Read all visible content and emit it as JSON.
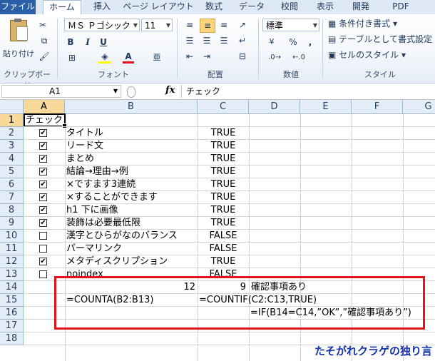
{
  "tabs": [
    "ファイル",
    "ホーム",
    "挿入",
    "ページ レイアウト",
    "数式",
    "データ",
    "校閲",
    "表示",
    "開発",
    "PDF"
  ],
  "ribbon": {
    "clipboard": {
      "paste": "貼り付け",
      "label": "クリップボード"
    },
    "font": {
      "name": "ＭＳ Ｐゴシック",
      "size": "11",
      "label": "フォント"
    },
    "alignment": {
      "label": "配置"
    },
    "number": {
      "format": "標準",
      "label": "数値"
    },
    "styles": {
      "conditional": "条件付き書式",
      "table": "テーブルとして書式設定",
      "cell": "セルのスタイル",
      "label": "スタイル"
    }
  },
  "formula_bar": {
    "name_box": "A1",
    "fx": "fx",
    "content": "チェック"
  },
  "columns": [
    "A",
    "B",
    "C",
    "D",
    "E",
    "F",
    "G"
  ],
  "rows": [
    {
      "n": "1",
      "a": "チェック",
      "b": "",
      "c": ""
    },
    {
      "n": "2",
      "check": true,
      "b": "タイトル",
      "c": "TRUE"
    },
    {
      "n": "3",
      "check": true,
      "b": "リード文",
      "c": "TRUE"
    },
    {
      "n": "4",
      "check": true,
      "b": "まとめ",
      "c": "TRUE"
    },
    {
      "n": "5",
      "check": true,
      "b": "結論→理由→例",
      "c": "TRUE"
    },
    {
      "n": "6",
      "check": true,
      "b": "×ですます3連続",
      "c": "TRUE"
    },
    {
      "n": "7",
      "check": true,
      "b": "×することができます",
      "c": "TRUE"
    },
    {
      "n": "8",
      "check": true,
      "b": "h1 下に画像",
      "c": "TRUE"
    },
    {
      "n": "9",
      "check": true,
      "b": "装飾は必要最低限",
      "c": "TRUE"
    },
    {
      "n": "10",
      "check": false,
      "b": "漢字とひらがなのバランス",
      "c": "FALSE"
    },
    {
      "n": "11",
      "check": false,
      "b": "パーマリンク",
      "c": "FALSE"
    },
    {
      "n": "12",
      "check": true,
      "b": "メタディスクリプション",
      "c": "TRUE"
    },
    {
      "n": "13",
      "check": false,
      "b": "noindex",
      "c": "FALSE"
    },
    {
      "n": "14"
    },
    {
      "n": "15"
    },
    {
      "n": "16"
    },
    {
      "n": "17"
    },
    {
      "n": "18"
    }
  ],
  "summary": {
    "b14": "12",
    "c14": "9",
    "d14": "確認事項あり",
    "b15": "=COUNTA(B2:B13)",
    "c15": "=COUNTIF(C2:C13,TRUE)",
    "d16": "=IF(B14=C14,”OK”,”確認事項あり”)"
  },
  "watermark": "たそがれクラゲの独り言",
  "colors": {
    "highlight_box": "#e0141c",
    "watermark": "#1533a8",
    "selected_header": "#f9d99a"
  }
}
